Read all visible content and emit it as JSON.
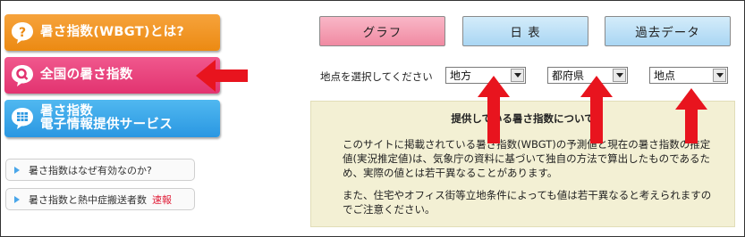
{
  "nav": {
    "wbgt_about": "暑さ指数(WBGT)とは?",
    "national": "全国の暑さ指数",
    "email_service_line1": "暑さ指数",
    "email_service_line2": "電子情報提供サービス"
  },
  "links": {
    "why_effective": "暑さ指数はなぜ有効なのか?",
    "heatstroke": "暑さ指数と熱中症搬送者数",
    "heatstroke_flash": "速報"
  },
  "tabs": {
    "graph": "グラフ",
    "table": "日 表",
    "past": "過去データ"
  },
  "selector": {
    "label": "地点を選択してください",
    "region": "地方",
    "prefecture": "都府県",
    "point": "地点"
  },
  "info": {
    "title": "提供している暑さ指数について",
    "paragraph1": "このサイトに掲載されている暑さ指数(WBGT)の予測値と現在の暑さ指数の推定値(実況推定値)は、気象庁の資料に基づいて独自の方法で算出したものであるため、実際の値とは若干異なることがあります。",
    "paragraph2": "また、住宅やオフィス街等立地条件によっても値は若干異なると考えられますのでご注意ください。"
  },
  "colors": {
    "arrow": "#e8141e",
    "orange": "#ec8a12",
    "pink": "#e23370",
    "blue": "#2a97e2"
  }
}
